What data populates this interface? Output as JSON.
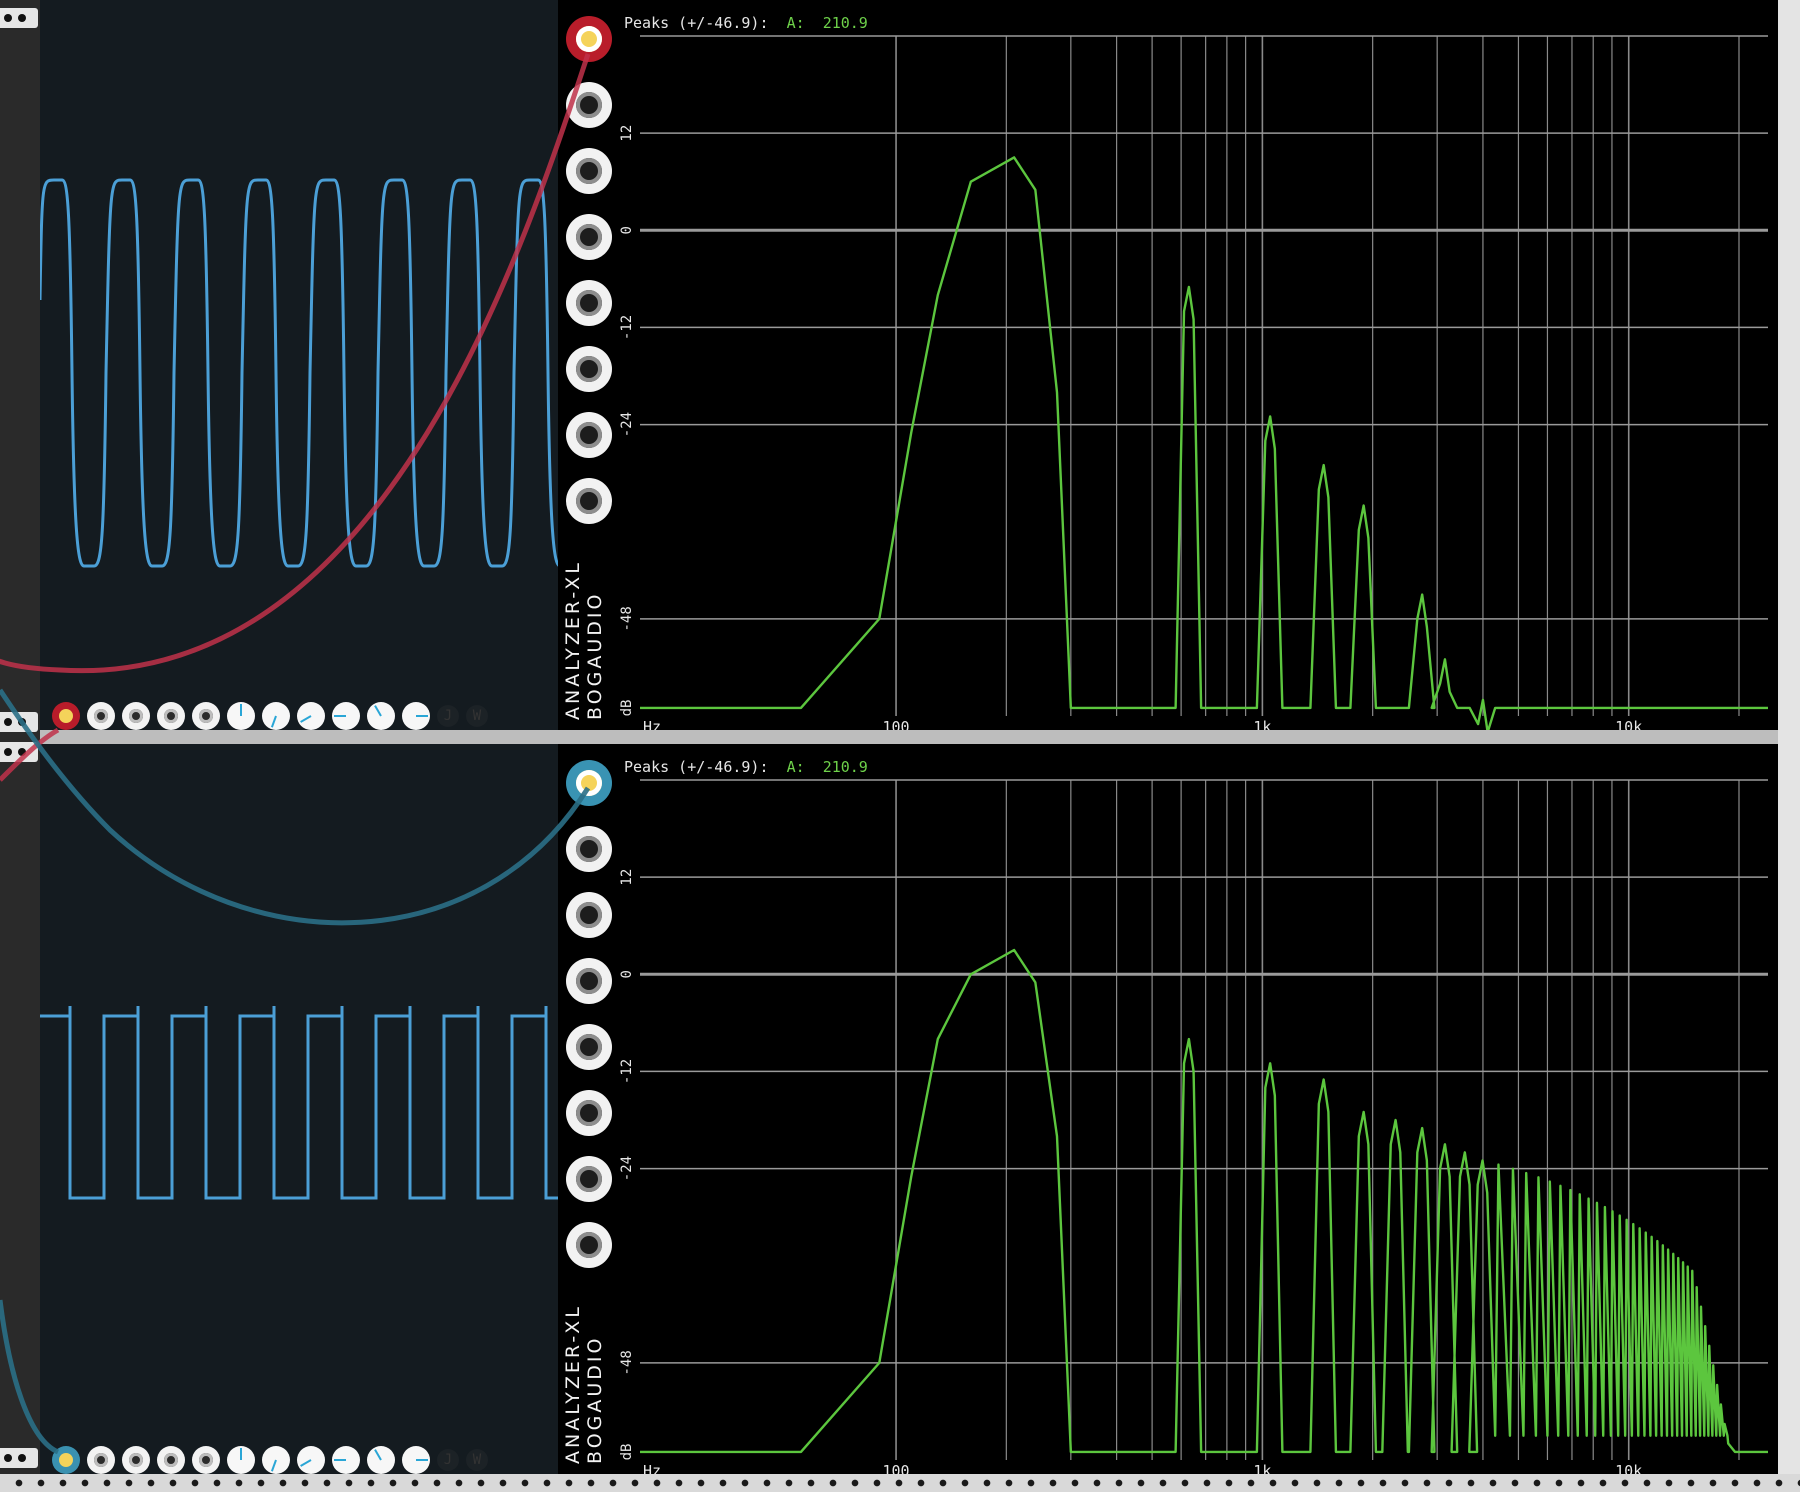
{
  "app": "VCV Rack",
  "modules": [
    {
      "scope": {
        "waveform": "rounded-square",
        "trace_color": "#4b9fd6",
        "cable_color": "#c0314a",
        "controls": [
          "jack-red",
          "jack",
          "jack",
          "jack",
          "jack",
          "knob",
          "knob",
          "knob",
          "knob",
          "knob",
          "knob"
        ],
        "buttons": [
          "J",
          "W"
        ]
      },
      "analyzer": {
        "peaks_label": "Peaks (+/-46.9):",
        "channel_label": "A:",
        "channel_value": "210.9",
        "brand_line1": "ANALYZER-XL",
        "brand_line2": "BOGAUDIO",
        "input_jacks": 8,
        "active_jack_color": "#b81c2a",
        "chart_data": {
          "type": "line",
          "x_scale": "log",
          "xlim": [
            20,
            24000
          ],
          "ylim": [
            -60,
            24
          ],
          "x_tick_labels": [
            "Hz",
            "100",
            "1k",
            "10k"
          ],
          "y_tick_labels": [
            "12",
            "0",
            "-12",
            "-24",
            "-48",
            "dB"
          ],
          "series": [
            {
              "color": "#5cc63e",
              "peaks_hz": [
                210,
                630,
                1050,
                1470,
                1890,
                2730,
                3150,
                4000
              ],
              "peaks_db": [
                9,
                -7,
                -23,
                -29,
                -34,
                -45,
                -53,
                -58
              ]
            }
          ],
          "grid": true
        }
      }
    },
    {
      "scope": {
        "waveform": "square",
        "trace_color": "#4b9fd6",
        "cable_color": "#2a6f86",
        "controls": [
          "jack-teal",
          "jack",
          "jack",
          "jack",
          "jack",
          "knob",
          "knob",
          "knob",
          "knob",
          "knob",
          "knob"
        ],
        "buttons": [
          "J",
          "W"
        ]
      },
      "analyzer": {
        "peaks_label": "Peaks (+/-46.9):",
        "channel_label": "A:",
        "channel_value": "210.9",
        "brand_line1": "ANALYZER-XL",
        "brand_line2": "BOGAUDIO",
        "input_jacks": 8,
        "active_jack_color": "#3a91b0",
        "chart_data": {
          "type": "line",
          "x_scale": "log",
          "xlim": [
            20,
            24000
          ],
          "ylim": [
            -60,
            24
          ],
          "x_tick_labels": [
            "Hz",
            "100",
            "1k",
            "10k"
          ],
          "y_tick_labels": [
            "12",
            "0",
            "-12",
            "-24",
            "-48",
            "dB"
          ],
          "series": [
            {
              "color": "#5cc63e",
              "peaks_hz": [
                210,
                630,
                1050,
                1470,
                1890,
                2310,
                2730,
                3150,
                3570,
                3990,
                5000,
                7000,
                10000,
                14000,
                17000
              ],
              "peaks_db": [
                3,
                -8,
                -11,
                -13,
                -17,
                -18,
                -19,
                -21,
                -22,
                -23,
                -24,
                -27,
                -31,
                -34,
                -42
              ]
            }
          ],
          "grid": true
        }
      }
    }
  ]
}
